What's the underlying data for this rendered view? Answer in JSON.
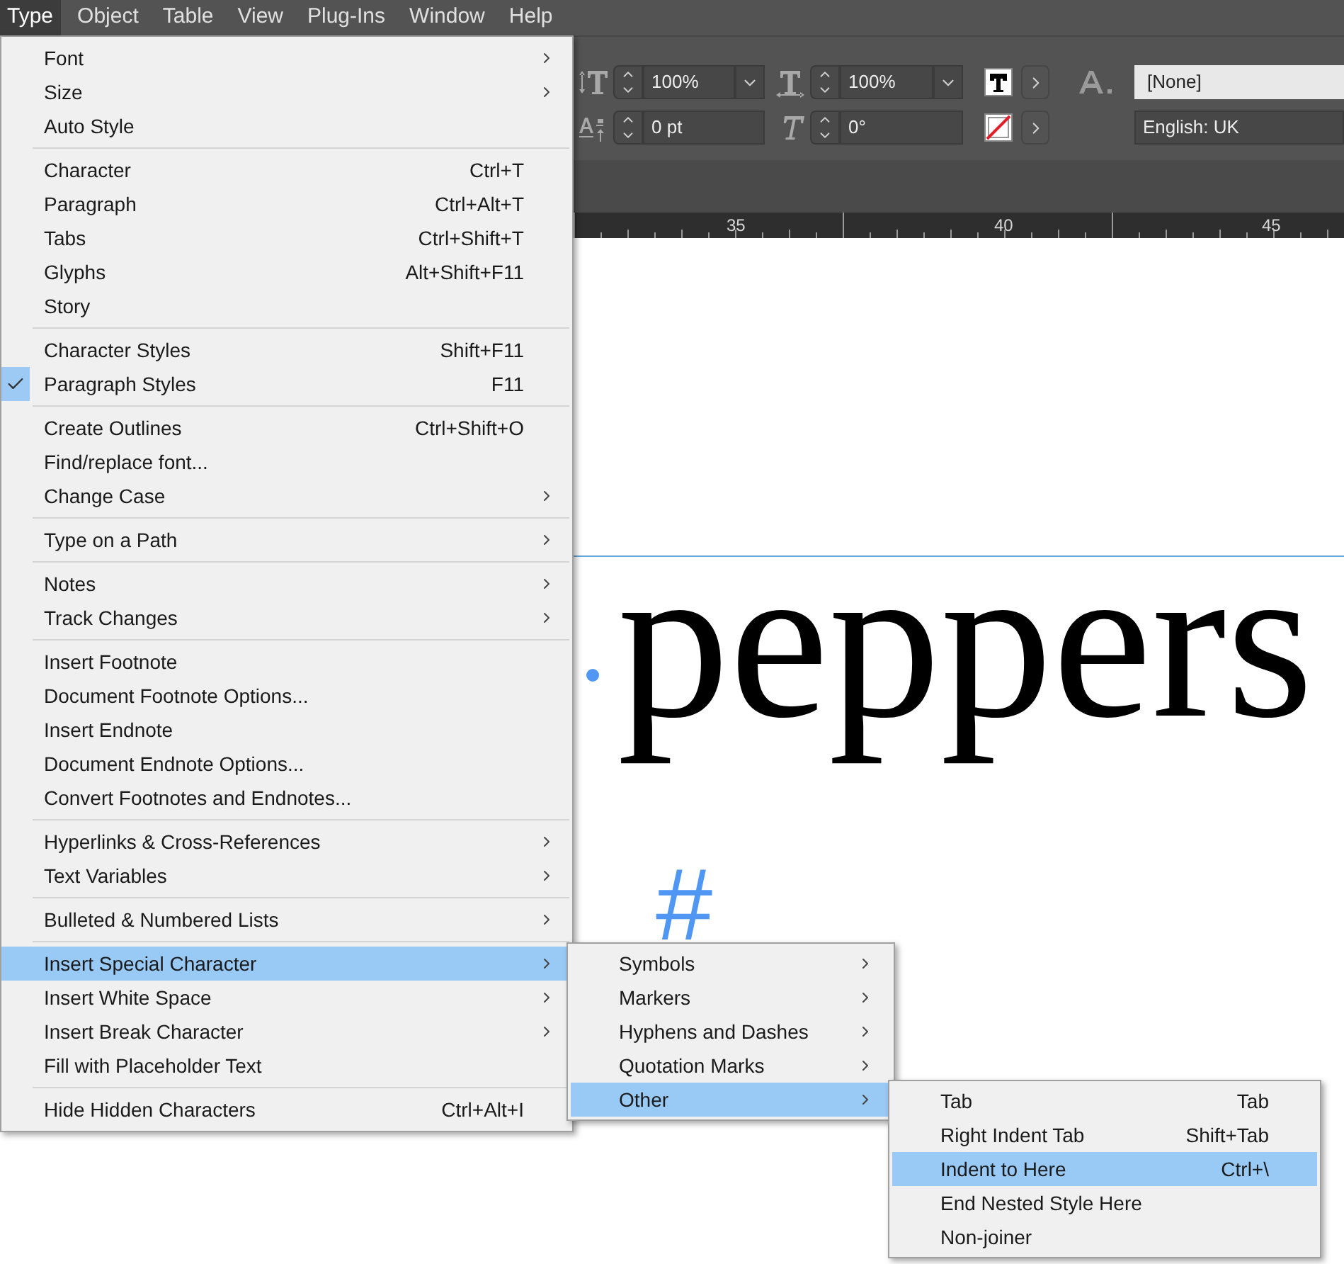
{
  "menubar": [
    {
      "label": "Type",
      "selected": true
    },
    {
      "label": "Object",
      "selected": false
    },
    {
      "label": "Table",
      "selected": false
    },
    {
      "label": "View",
      "selected": false
    },
    {
      "label": "Plug-Ins",
      "selected": false
    },
    {
      "label": "Window",
      "selected": false
    },
    {
      "label": "Help",
      "selected": false
    }
  ],
  "toolbar": {
    "vertical_scale": "100%",
    "horizontal_scale": "100%",
    "baseline_shift": "0 pt",
    "skew": "0°",
    "character_style": "[None]",
    "language": "English: UK"
  },
  "ruler": [
    "35",
    "40",
    "45"
  ],
  "document": {
    "word": "peppers",
    "hidden_character": "#"
  },
  "menu": {
    "items": [
      {
        "kind": "item",
        "label": "Font",
        "submenu": true,
        "checked": false,
        "selected": false
      },
      {
        "kind": "item",
        "label": "Size",
        "submenu": true,
        "checked": false,
        "selected": false
      },
      {
        "kind": "item",
        "label": "Auto Style",
        "submenu": false,
        "checked": false,
        "selected": false
      },
      {
        "kind": "separator"
      },
      {
        "kind": "item",
        "label": "Character",
        "shortcut": "Ctrl+T",
        "submenu": false,
        "checked": false,
        "selected": false
      },
      {
        "kind": "item",
        "label": "Paragraph",
        "shortcut": "Ctrl+Alt+T",
        "submenu": false,
        "checked": false,
        "selected": false
      },
      {
        "kind": "item",
        "label": "Tabs",
        "shortcut": "Ctrl+Shift+T",
        "submenu": false,
        "checked": false,
        "selected": false
      },
      {
        "kind": "item",
        "label": "Glyphs",
        "shortcut": "Alt+Shift+F11",
        "submenu": false,
        "checked": false,
        "selected": false
      },
      {
        "kind": "item",
        "label": "Story",
        "submenu": false,
        "checked": false,
        "selected": false
      },
      {
        "kind": "separator"
      },
      {
        "kind": "item",
        "label": "Character Styles",
        "shortcut": "Shift+F11",
        "submenu": false,
        "checked": false,
        "selected": false
      },
      {
        "kind": "item",
        "label": "Paragraph Styles",
        "shortcut": "F11",
        "submenu": false,
        "checked": true,
        "selected": false
      },
      {
        "kind": "separator"
      },
      {
        "kind": "item",
        "label": "Create Outlines",
        "shortcut": "Ctrl+Shift+O",
        "submenu": false,
        "checked": false,
        "selected": false
      },
      {
        "kind": "item",
        "label": "Find/replace font...",
        "submenu": false,
        "checked": false,
        "selected": false
      },
      {
        "kind": "item",
        "label": "Change Case",
        "submenu": true,
        "checked": false,
        "selected": false
      },
      {
        "kind": "separator"
      },
      {
        "kind": "item",
        "label": "Type on a Path",
        "submenu": true,
        "checked": false,
        "selected": false
      },
      {
        "kind": "separator"
      },
      {
        "kind": "item",
        "label": "Notes",
        "submenu": true,
        "checked": false,
        "selected": false
      },
      {
        "kind": "item",
        "label": "Track Changes",
        "submenu": true,
        "checked": false,
        "selected": false
      },
      {
        "kind": "separator"
      },
      {
        "kind": "item",
        "label": "Insert Footnote",
        "submenu": false,
        "checked": false,
        "selected": false
      },
      {
        "kind": "item",
        "label": "Document Footnote Options...",
        "submenu": false,
        "checked": false,
        "selected": false
      },
      {
        "kind": "item",
        "label": "Insert Endnote",
        "submenu": false,
        "checked": false,
        "selected": false
      },
      {
        "kind": "item",
        "label": "Document Endnote Options...",
        "submenu": false,
        "checked": false,
        "selected": false
      },
      {
        "kind": "item",
        "label": "Convert Footnotes and Endnotes...",
        "submenu": false,
        "checked": false,
        "selected": false
      },
      {
        "kind": "separator"
      },
      {
        "kind": "item",
        "label": "Hyperlinks & Cross-References",
        "submenu": true,
        "checked": false,
        "selected": false
      },
      {
        "kind": "item",
        "label": "Text Variables",
        "submenu": true,
        "checked": false,
        "selected": false
      },
      {
        "kind": "separator"
      },
      {
        "kind": "item",
        "label": "Bulleted & Numbered Lists",
        "submenu": true,
        "checked": false,
        "selected": false
      },
      {
        "kind": "separator"
      },
      {
        "kind": "item",
        "label": "Insert Special Character",
        "submenu": true,
        "checked": false,
        "selected": true
      },
      {
        "kind": "item",
        "label": "Insert White Space",
        "submenu": true,
        "checked": false,
        "selected": false
      },
      {
        "kind": "item",
        "label": "Insert Break Character",
        "submenu": true,
        "checked": false,
        "selected": false
      },
      {
        "kind": "item",
        "label": "Fill with Placeholder Text",
        "submenu": false,
        "checked": false,
        "selected": false
      },
      {
        "kind": "separator"
      },
      {
        "kind": "item",
        "label": "Hide Hidden Characters",
        "shortcut": "Ctrl+Alt+I",
        "submenu": false,
        "checked": false,
        "selected": false
      }
    ]
  },
  "special_character_menu": {
    "items": [
      {
        "label": "Symbols",
        "submenu": true,
        "selected": false
      },
      {
        "label": "Markers",
        "submenu": true,
        "selected": false
      },
      {
        "label": "Hyphens and Dashes",
        "submenu": true,
        "selected": false
      },
      {
        "label": "Quotation Marks",
        "submenu": true,
        "selected": false
      },
      {
        "label": "Other",
        "submenu": true,
        "selected": true
      }
    ]
  },
  "other_menu": {
    "items": [
      {
        "label": "Tab",
        "shortcut": "Tab",
        "submenu": false,
        "selected": false
      },
      {
        "label": "Right Indent Tab",
        "shortcut": "Shift+Tab",
        "submenu": false,
        "selected": false
      },
      {
        "label": "Indent to Here",
        "shortcut": "Ctrl+\\",
        "submenu": false,
        "selected": true
      },
      {
        "label": "End Nested Style Here",
        "submenu": false,
        "selected": false
      },
      {
        "label": "Non-joiner",
        "submenu": false,
        "selected": false
      }
    ]
  }
}
